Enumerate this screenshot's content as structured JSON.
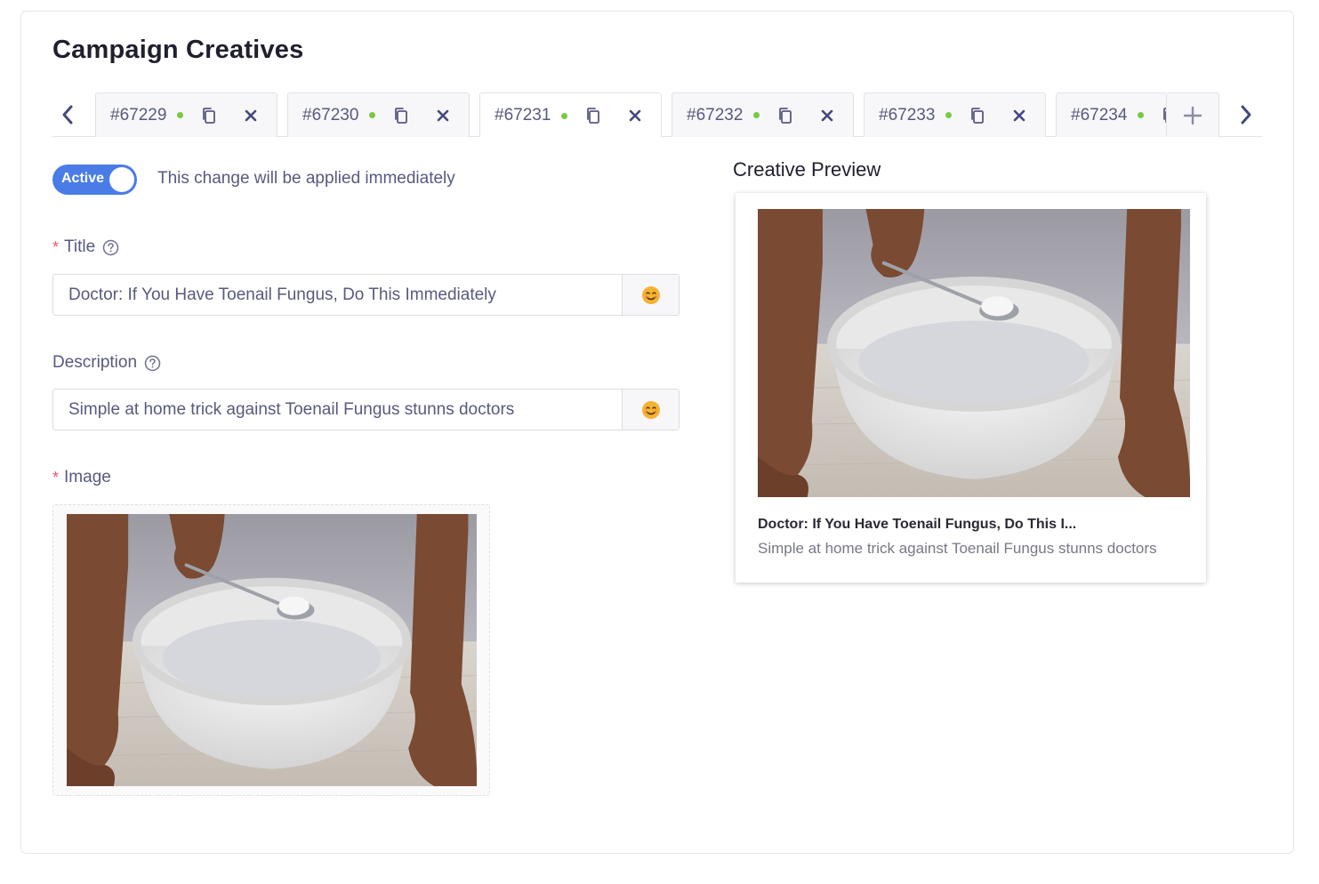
{
  "page": {
    "title": "Campaign Creatives"
  },
  "tabs": {
    "items": [
      {
        "label": "#67229",
        "status": "active"
      },
      {
        "label": "#67230",
        "status": "active"
      },
      {
        "label": "#67231",
        "status": "active",
        "selected": true
      },
      {
        "label": "#67232",
        "status": "active"
      },
      {
        "label": "#67233",
        "status": "active"
      },
      {
        "label": "#67234",
        "status": "active"
      }
    ],
    "add_icon": "plus-icon",
    "prev_icon": "chevron-left-icon",
    "next_icon": "chevron-right-icon"
  },
  "status_toggle": {
    "label": "Active",
    "on": true,
    "note": "This change will be applied immediately"
  },
  "form": {
    "title": {
      "label": "Title",
      "required": true,
      "value": "Doctor: If You Have Toenail Fungus, Do This Immediately"
    },
    "description": {
      "label": "Description",
      "required": false,
      "value": "Simple at home trick against Toenail Fungus stunns doctors"
    },
    "image": {
      "label": "Image",
      "required": true
    }
  },
  "preview": {
    "heading": "Creative Preview",
    "title": "Doctor: If You Have Toenail Fungus, Do This I...",
    "description": "Simple at home trick against Toenail Fungus stunns doctors"
  },
  "colors": {
    "accent": "#4a7ce8",
    "status_dot": "#7ac943",
    "required": "#f0566a",
    "text": "#58597f"
  }
}
